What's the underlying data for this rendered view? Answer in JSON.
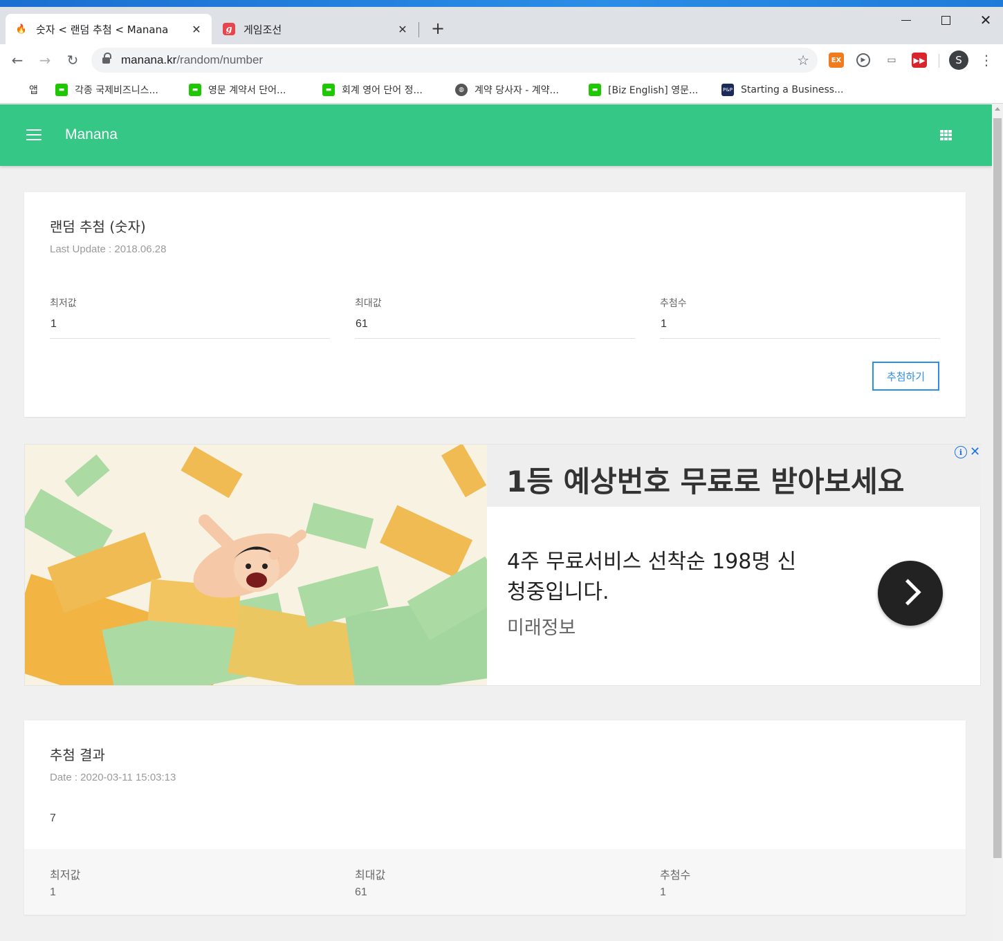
{
  "browser": {
    "tabs": [
      {
        "title": "숫자 < 랜덤 추첨 < Manana",
        "active": true,
        "icon": "fire-icon"
      },
      {
        "title": "게임조선",
        "active": false,
        "icon": "g-icon"
      }
    ],
    "url_host": "manana.kr",
    "url_path": "/random/number",
    "profile_initial": "S",
    "extensions": {
      "ex_label": "EX"
    },
    "bookmarks": [
      {
        "label": "앱",
        "icon": "apps-grid-icon"
      },
      {
        "label": "각종 국제비즈니스...",
        "icon": "line-icon"
      },
      {
        "label": "영문 계약서 단어...",
        "icon": "line-icon"
      },
      {
        "label": "회계 영어 단어 정...",
        "icon": "line-icon"
      },
      {
        "label": "계약 당사자 - 계약...",
        "icon": "globe-icon"
      },
      {
        "label": "[Biz English] 영문...",
        "icon": "line-icon"
      },
      {
        "label": "Starting a Business...",
        "icon": "pp-icon"
      }
    ]
  },
  "appbar": {
    "brand": "Manana",
    "color": "#34c785"
  },
  "draw_card": {
    "title": "랜덤 추첨 (숫자)",
    "last_update": "Last Update : 2018.06.28",
    "fields": [
      {
        "label": "최저값",
        "value": "1"
      },
      {
        "label": "최대값",
        "value": "61"
      },
      {
        "label": "추첨수",
        "value": "1"
      }
    ],
    "button_label": "추첨하기",
    "button_color": "#2b8ee8"
  },
  "ad": {
    "headline": "1등 예상번호 무료로 받아보세요",
    "body": "4주 무료서비스 선착순 198명 신청중입니다.",
    "advertiser": "미래정보"
  },
  "result_card": {
    "title": "추첨 결과",
    "date": "Date : 2020-03-11 15:03:13",
    "result": "7",
    "summary": [
      {
        "label": "최저값",
        "value": "1"
      },
      {
        "label": "최대값",
        "value": "61"
      },
      {
        "label": "추첨수",
        "value": "1"
      }
    ]
  }
}
